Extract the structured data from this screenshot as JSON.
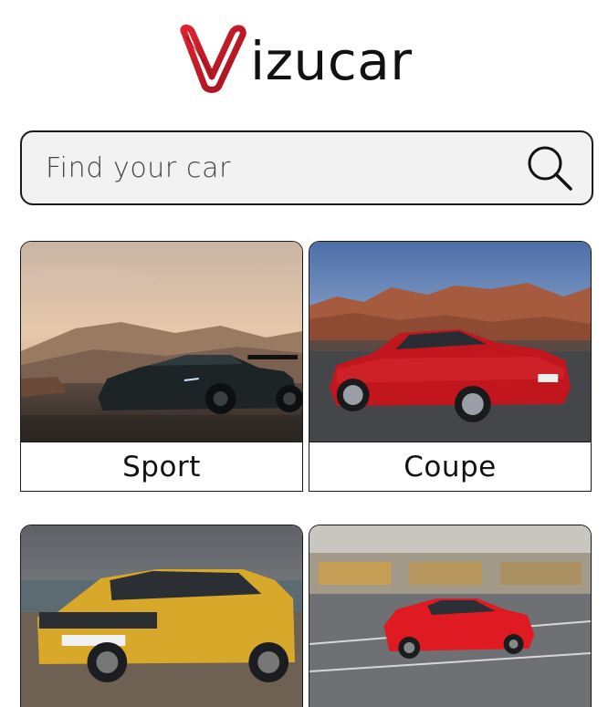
{
  "brand": {
    "name": "izucar",
    "logo_mark": "V",
    "logo_color": "#c81e2a"
  },
  "search": {
    "placeholder": "Find your car",
    "value": "",
    "icon": "search-icon"
  },
  "categories": [
    {
      "label": "Sport",
      "image": "black-supercar-desert-sunset"
    },
    {
      "label": "Coupe",
      "image": "red-coupe-red-rocks"
    },
    {
      "label": "",
      "image": "yellow-suv-coast"
    },
    {
      "label": "",
      "image": "red-sedan-city-motion"
    }
  ]
}
